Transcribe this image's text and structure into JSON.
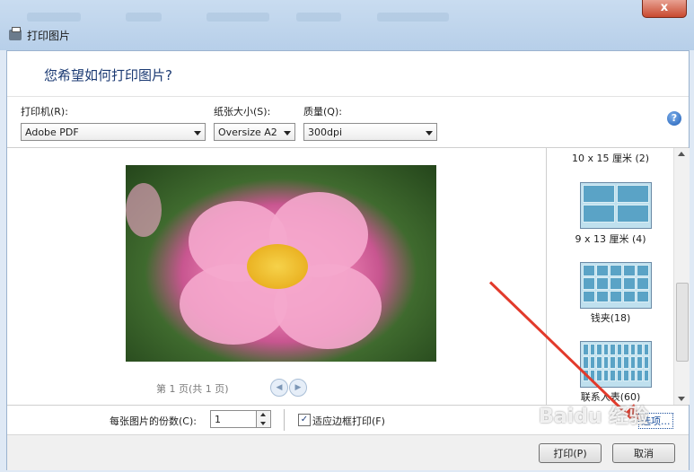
{
  "window": {
    "title": "打印图片",
    "close_glyph": "x"
  },
  "heading": "您希望如何打印图片?",
  "controls": {
    "printer_label": "打印机(R):",
    "printer_value": "Adobe PDF",
    "paper_label": "纸张大小(S):",
    "paper_value": "Oversize A2",
    "quality_label": "质量(Q):",
    "quality_value": "300dpi",
    "help_glyph": "?"
  },
  "preview": {
    "page_info": "第 1 页(共 1 页)",
    "prev_glyph": "◀",
    "next_glyph": "▶"
  },
  "sizes": [
    {
      "label": "10 x 15 厘米 (2)"
    },
    {
      "label": "9 x 13 厘米 (4)"
    },
    {
      "label": "钱夹(18)"
    },
    {
      "label": "联系人表(60)"
    }
  ],
  "bottom": {
    "copies_label": "每张图片的份数(C):",
    "copies_value": "1",
    "fit_label": "适应边框打印(F)",
    "fit_checked_glyph": "✓",
    "options_link": "选项..."
  },
  "footer": {
    "print_button": "打印(P)",
    "cancel_button": "取消"
  },
  "watermark": "Baidu 经验",
  "colors": {
    "accent": "#1b3a73",
    "arrow": "#e23a2b"
  }
}
